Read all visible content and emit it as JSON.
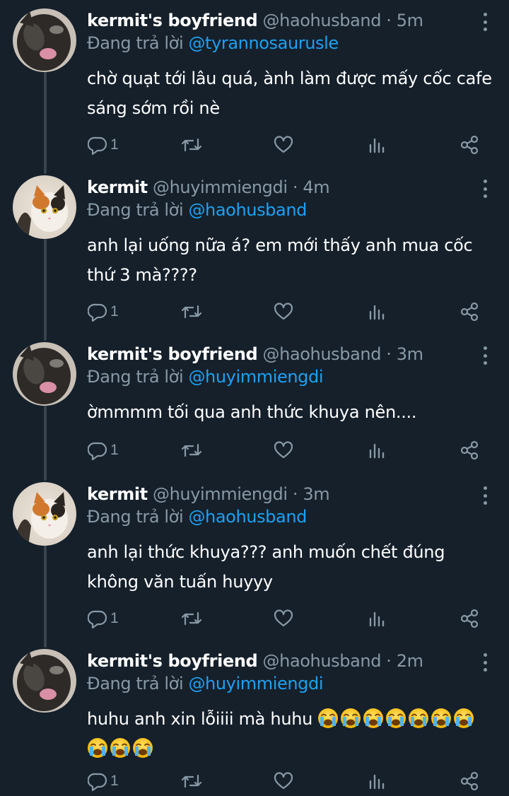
{
  "tweets": [
    {
      "display_name": "kermit's boyfriend",
      "handle": "@haohusband",
      "separator": "·",
      "time": "5m",
      "reply_prefix": "Đang trả lời",
      "reply_to": "@tyrannosaurusle",
      "text": "chờ quạt tới lâu quá, ành làm được mấy cốc cafe sáng sớm rồi nè",
      "reply_count": "1",
      "avatar": "black-cat-avatar"
    },
    {
      "display_name": "kermit",
      "handle": "@huyimmiengdi",
      "separator": "·",
      "time": "4m",
      "reply_prefix": "Đang trả lời",
      "reply_to": "@haohusband",
      "text": "anh lại uống nữa á? em mới thấy anh mua cốc thứ 3 mà????",
      "reply_count": "1",
      "avatar": "calico-cat-avatar"
    },
    {
      "display_name": "kermit's boyfriend",
      "handle": "@haohusband",
      "separator": "·",
      "time": "3m",
      "reply_prefix": "Đang trả lời",
      "reply_to": "@huyimmiengdi",
      "text": "ờmmmm tối qua anh thức khuya nên....",
      "reply_count": "1",
      "avatar": "black-cat-avatar"
    },
    {
      "display_name": "kermit",
      "handle": "@huyimmiengdi",
      "separator": "·",
      "time": "3m",
      "reply_prefix": "Đang trả lời",
      "reply_to": "@haohusband",
      "text": "anh lại thức khuya??? anh muốn chết đúng không văn tuấn huyyy",
      "reply_count": "1",
      "avatar": "calico-cat-avatar"
    },
    {
      "display_name": "kermit's boyfriend",
      "handle": "@haohusband",
      "separator": "·",
      "time": "2m",
      "reply_prefix": "Đang trả lời",
      "reply_to": "@huyimmiengdi",
      "text": "huhu anh xin lỗiiii mà huhu",
      "emoji": "😭😭😭😭😭😭😭😭😭😭",
      "emoji_name": "loudly-crying-face-icon",
      "reply_count": "1",
      "avatar": "black-cat-avatar"
    }
  ],
  "icons": {
    "reply": "speech-bubble-icon",
    "retweet": "retweet-arrows-icon",
    "like": "heart-icon",
    "stats": "bar-chart-icon",
    "share": "share-icon",
    "more": "vertical-ellipsis-icon"
  },
  "colors": {
    "background": "#15202b",
    "primary_text": "#ffffff",
    "secondary_text": "#8899a6",
    "link": "#1da1f2",
    "thread_line": "#38444d"
  }
}
